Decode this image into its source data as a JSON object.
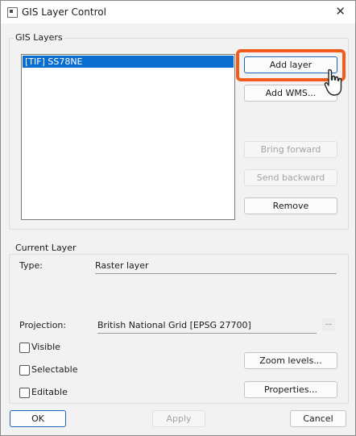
{
  "window": {
    "title": "GIS Layer Control"
  },
  "gis_layers": {
    "group_label": "GIS Layers",
    "layers": [
      "[TIF] SS78NE"
    ],
    "buttons": {
      "add_layer": "Add layer",
      "add_wms": "Add WMS...",
      "bring_forward": "Bring forward",
      "send_backward": "Send backward",
      "remove": "Remove"
    }
  },
  "current_layer": {
    "group_label": "Current Layer",
    "type_label": "Type:",
    "type_value": "Raster layer",
    "projection_label": "Projection:",
    "projection_value": "British National Grid [EPSG 27700]",
    "projection_browse": "...",
    "checkboxes": [
      {
        "label": "Visible",
        "checked": false
      },
      {
        "label": "Selectable",
        "checked": false
      },
      {
        "label": "Editable",
        "checked": false
      }
    ],
    "buttons": {
      "zoom_levels": "Zoom levels...",
      "properties": "Properties..."
    }
  },
  "footer": {
    "ok": "OK",
    "apply": "Apply",
    "cancel": "Cancel"
  },
  "icons": {
    "app": "window-icon",
    "close": "close-icon",
    "cursor": "mouse-pointer-icon"
  },
  "colors": {
    "highlight": "#f45a1c",
    "selection": "#0a6ed1"
  }
}
